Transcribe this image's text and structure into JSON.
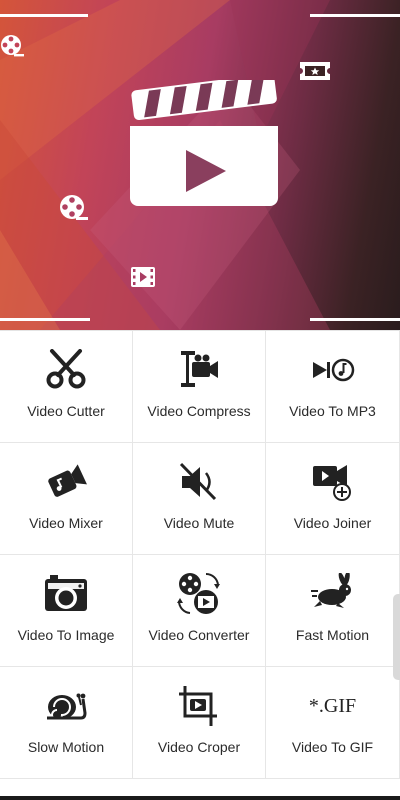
{
  "header": {
    "accent_colors": [
      "#d4553a",
      "#a83c62",
      "#2a1c1d"
    ]
  },
  "tools": [
    {
      "label": "Video Cutter",
      "icon": "scissors-icon"
    },
    {
      "label": "Video Compress",
      "icon": "compress-camera-icon"
    },
    {
      "label": "Video To MP3",
      "icon": "play-music-icon"
    },
    {
      "label": "Video Mixer",
      "icon": "mixer-camera-icon"
    },
    {
      "label": "Video Mute",
      "icon": "mute-speaker-icon"
    },
    {
      "label": "Video Joiner",
      "icon": "camera-plus-icon"
    },
    {
      "label": "Video To Image",
      "icon": "photo-camera-icon"
    },
    {
      "label": "Video Converter",
      "icon": "convert-reels-icon"
    },
    {
      "label": "Fast Motion",
      "icon": "rabbit-icon"
    },
    {
      "label": "Slow Motion",
      "icon": "snail-icon"
    },
    {
      "label": "Video Croper",
      "icon": "crop-play-icon"
    },
    {
      "label": "Video To GIF",
      "icon": "gif-text-icon"
    }
  ],
  "gif_icon_text": "*.GIF"
}
